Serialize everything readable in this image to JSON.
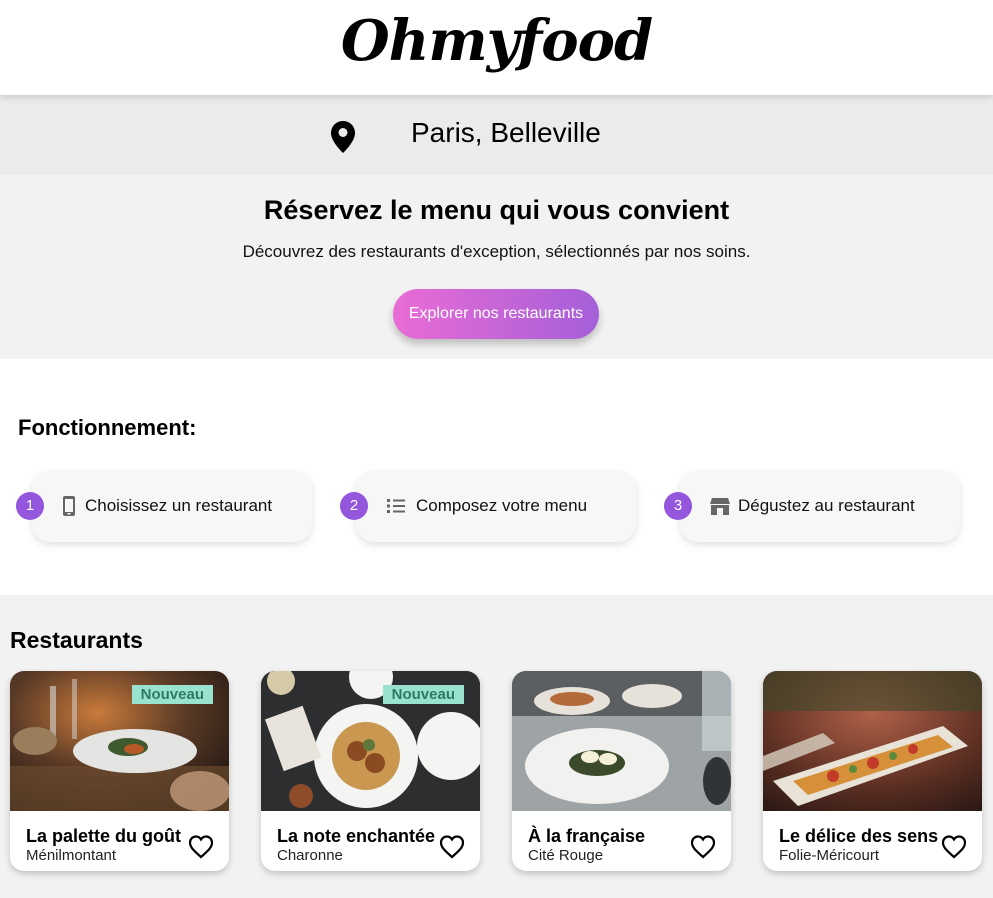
{
  "header": {
    "logo": "Ohmyfood"
  },
  "location": {
    "icon": "map-pin-icon",
    "text": "Paris, Belleville"
  },
  "hero": {
    "title": "Réservez le menu qui vous convient",
    "subtitle": "Découvrez des restaurants d'exception, sélectionnés par nos soins.",
    "button_label": "Explorer nos restaurants",
    "button_colors": [
      "#e96cd6",
      "#a55fd8"
    ]
  },
  "how": {
    "title": "Fonctionnement:",
    "steps": [
      {
        "number": "1",
        "icon": "phone-icon",
        "label": "Choisissez un restaurant"
      },
      {
        "number": "2",
        "icon": "list-icon",
        "label": "Composez votre menu"
      },
      {
        "number": "3",
        "icon": "store-icon",
        "label": "Dégustez au restaurant"
      }
    ]
  },
  "restaurants": {
    "title": "Restaurants",
    "badge_label": "Nouveau",
    "items": [
      {
        "name": "La palette du goût",
        "location": "Ménilmontant",
        "new": true
      },
      {
        "name": "La note enchantée",
        "location": "Charonne",
        "new": true
      },
      {
        "name": "À la française",
        "location": "Cité Rouge",
        "new": false
      },
      {
        "name": "Le délice des sens",
        "location": "Folie-Méricourt",
        "new": false
      }
    ]
  },
  "colors": {
    "accent": "#9356dc",
    "badge_bg": "#99e2d0",
    "badge_text": "#2f7a67"
  }
}
